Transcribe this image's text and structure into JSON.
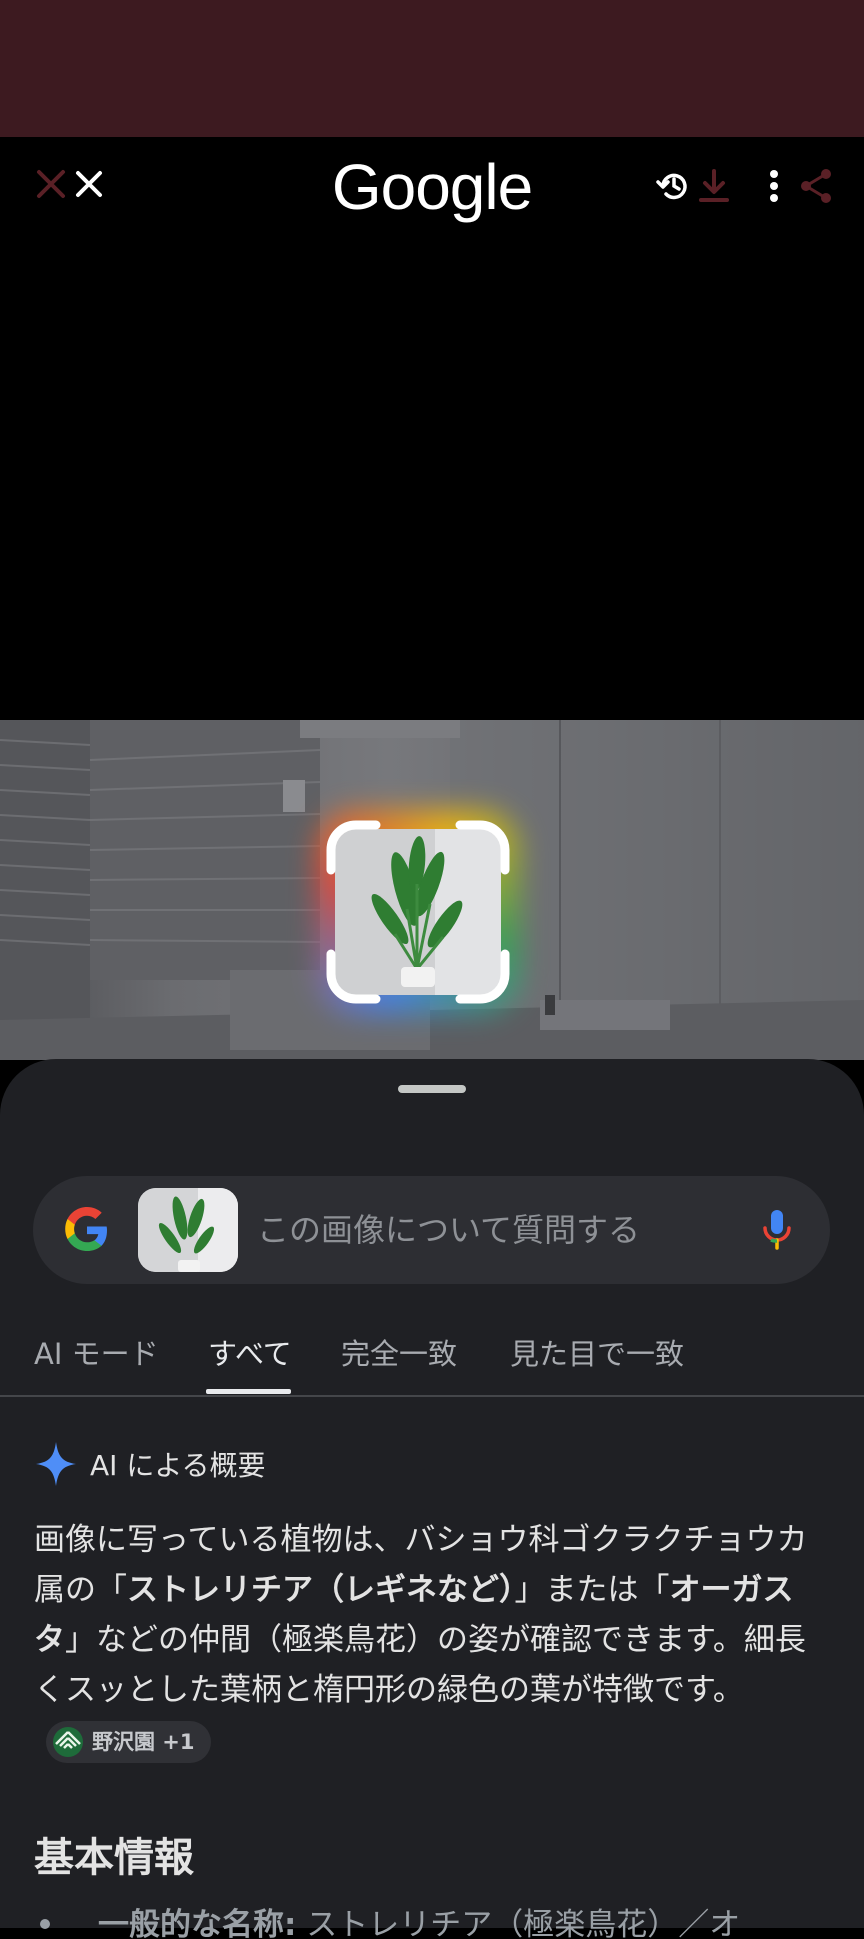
{
  "app": {
    "logo_text": "Google"
  },
  "toolbar": {
    "icons": [
      "close-icon",
      "history-icon",
      "download-icon",
      "more-vert-icon",
      "share-icon"
    ]
  },
  "search": {
    "placeholder": "この画像について質問する"
  },
  "tabs": [
    {
      "label": "AI モード",
      "active": false
    },
    {
      "label": "すべて",
      "active": true
    },
    {
      "label": "完全一致",
      "active": false
    },
    {
      "label": "見た目で一致",
      "active": false
    }
  ],
  "overview": {
    "title": "AI による概要",
    "text_1": "画像に写っている植物は、バショウ科ゴクラクチョウカ属の「",
    "bold_1": "ストレリチア（レギネなど）",
    "text_2": "」または「",
    "bold_2": "オーガスタ",
    "text_3": "」などの仲間（極楽鳥花）の姿が確認できます。細長くスッとした葉柄と楕円形の緑色の葉が特徴です。",
    "source_label": "野沢園 +1"
  },
  "basic_info": {
    "heading": "基本情報",
    "bullet_label": "一般的な名称:",
    "bullet_text": " ストレリチア（極楽鳥花）／オ"
  },
  "colors": {
    "status_strip": "#3d1a20",
    "sheet": "#1f2024",
    "accent_star": "#4f8ef7"
  }
}
